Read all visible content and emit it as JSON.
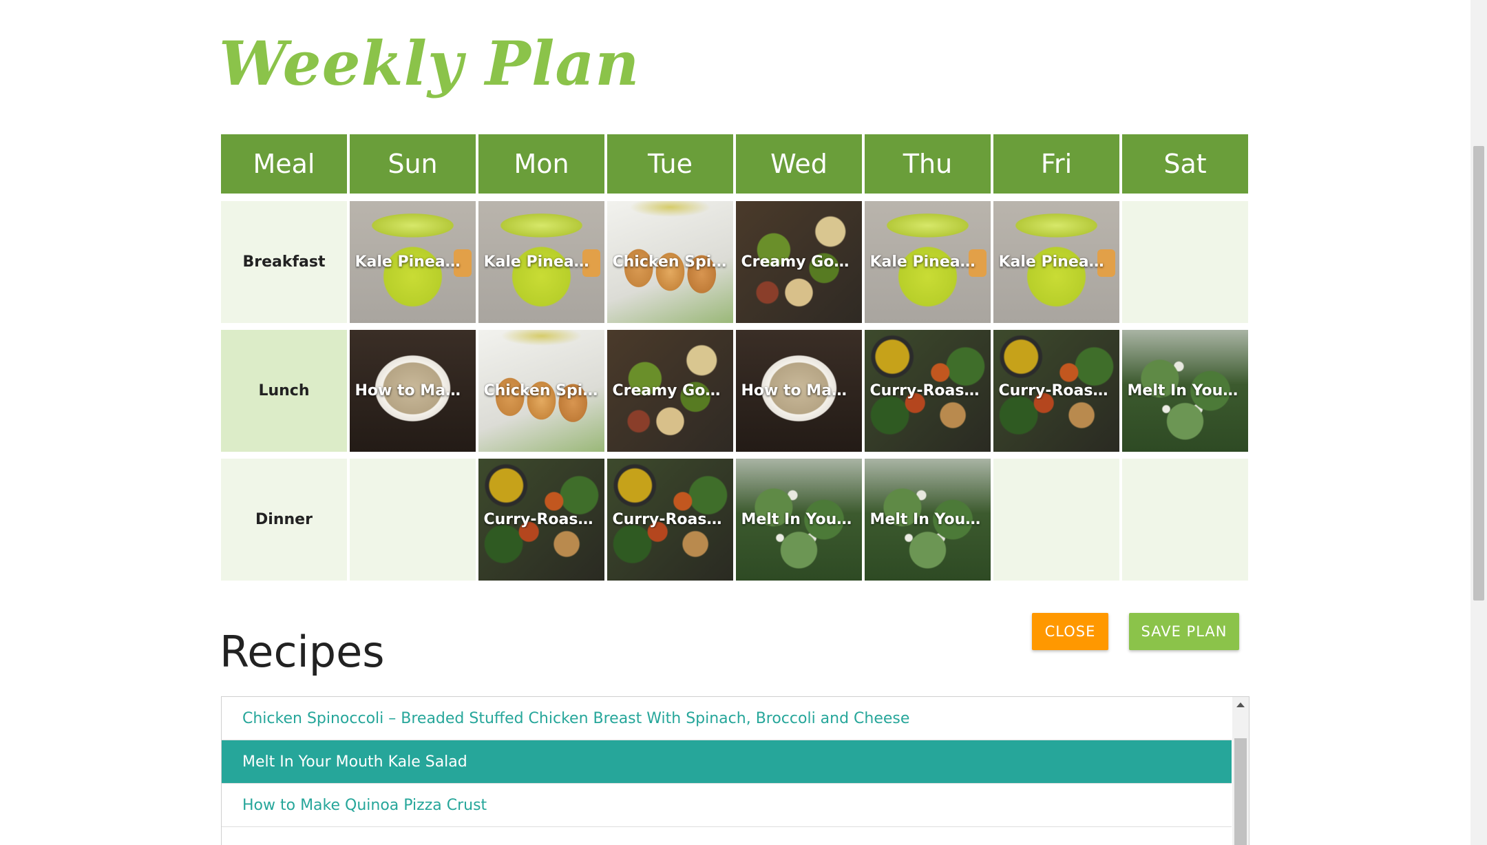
{
  "page": {
    "title": "Weekly Plan"
  },
  "plan": {
    "headers": [
      "Meal",
      "Sun",
      "Mon",
      "Tue",
      "Wed",
      "Thu",
      "Fri",
      "Sat"
    ],
    "rows": [
      {
        "meal": "Breakfast",
        "cells": [
          {
            "title": "Kale Pineapp…",
            "image": "smoothie"
          },
          {
            "title": "Kale Pineapp…",
            "image": "smoothie"
          },
          {
            "title": "Chicken Spin…",
            "image": "chicken"
          },
          {
            "title": "Creamy Goat…",
            "image": "pasta"
          },
          {
            "title": "Kale Pineapp…",
            "image": "smoothie"
          },
          {
            "title": "Kale Pineapp…",
            "image": "smoothie"
          },
          null
        ]
      },
      {
        "meal": "Lunch",
        "cells": [
          {
            "title": "How to Mak…",
            "image": "quinoa"
          },
          {
            "title": "Chicken Spin…",
            "image": "chicken"
          },
          {
            "title": "Creamy Goat…",
            "image": "pasta"
          },
          {
            "title": "How to Mak…",
            "image": "quinoa"
          },
          {
            "title": "Curry-Roaste…",
            "image": "curry"
          },
          {
            "title": "Curry-Roaste…",
            "image": "curry"
          },
          {
            "title": "Melt In Your …",
            "image": "kale"
          }
        ]
      },
      {
        "meal": "Dinner",
        "cells": [
          null,
          {
            "title": "Curry-Roaste…",
            "image": "curry"
          },
          {
            "title": "Curry-Roaste…",
            "image": "curry"
          },
          {
            "title": "Melt In Your …",
            "image": "kale"
          },
          {
            "title": "Melt In Your …",
            "image": "kale"
          },
          null,
          null
        ]
      }
    ]
  },
  "buttons": {
    "close": "CLOSE",
    "save": "SAVE PLAN"
  },
  "recipes": {
    "title": "Recipes",
    "selected_index": 1,
    "items": [
      "Chicken Spinoccoli – Breaded Stuffed Chicken Breast With Spinach, Broccoli and Cheese",
      "Melt In Your Mouth Kale Salad",
      "How to Make Quinoa Pizza Crust",
      ""
    ]
  },
  "colors": {
    "title": "#8bc34a",
    "header_bg": "#6a9e3a",
    "cell_bg": "#f0f6e8",
    "accent_teal": "#26a69a",
    "close_btn": "#ff9800",
    "save_btn": "#8bc34a"
  }
}
